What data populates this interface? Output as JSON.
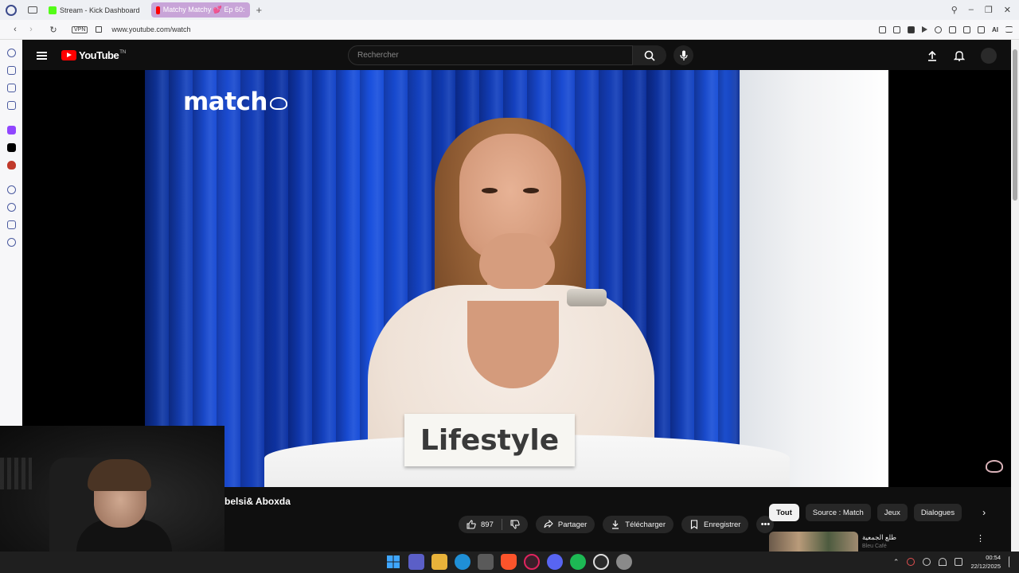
{
  "browser": {
    "tabs": [
      {
        "label": "Stream - Kick Dashboard",
        "favicon_color": "#53fc18"
      },
      {
        "label": "Matchy Matchy 💕 Ep 60:",
        "favicon_color": "#ff0000"
      }
    ],
    "url": "www.youtube.com/watch",
    "vpn_label": "VPN",
    "ai_label": "AI",
    "extension_icons": [
      "bookmark-icon",
      "screenshot-icon",
      "shield-icon",
      "play-icon",
      "heart-icon",
      "puzzle-icon",
      "history-icon",
      "download-icon"
    ],
    "rail_icons": [
      "clock-icon",
      "cube-icon",
      "layers-icon",
      "calendar-icon",
      "twitch-icon",
      "x-icon",
      "ublock-icon",
      "history-icon",
      "clock-icon",
      "extensions-icon",
      "settings-icon"
    ]
  },
  "youtube": {
    "wordmark": "YouTube",
    "trademark": "TN",
    "search_placeholder": "Rechercher",
    "accent": "#ff0000"
  },
  "video": {
    "brand_logo": "match",
    "sign_text": "Lifestyle"
  },
  "below_video": {
    "title": "belsi& Aboxda",
    "likes": "897",
    "share_label": "Partager",
    "download_label": "Télécharger",
    "save_label": "Enregistrer",
    "more_label": "•••"
  },
  "chips": [
    "Tout",
    "Source : Match",
    "Jeux",
    "Dialogues"
  ],
  "recommendation": {
    "title": "طلع الجمعية",
    "channel": "Bleu Café"
  },
  "taskbar": {
    "time": "00:54",
    "date": "22/12/2025"
  }
}
